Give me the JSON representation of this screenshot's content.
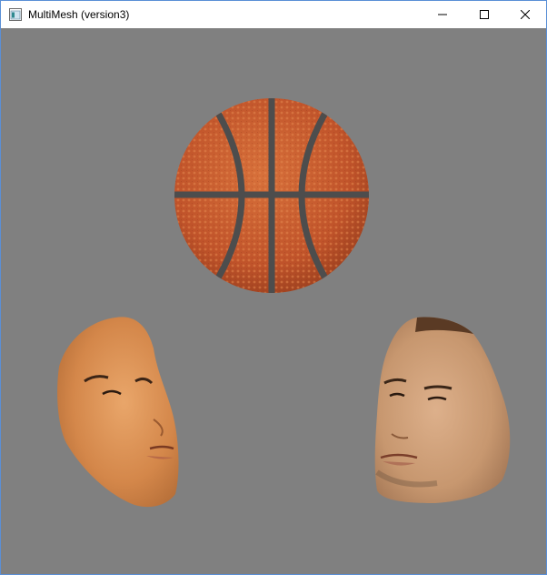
{
  "window": {
    "title": "MultiMesh (version3)",
    "background_color": "#808080"
  },
  "titlebar": {
    "app_icon": "window-app-icon",
    "buttons": [
      {
        "name": "minimize",
        "icon": "minimize-icon"
      },
      {
        "name": "maximize",
        "icon": "maximize-icon"
      },
      {
        "name": "close",
        "icon": "close-icon"
      }
    ]
  },
  "scene": {
    "objects": [
      {
        "name": "basketball",
        "color": "#c4572a",
        "seam_color": "#4a4a4a"
      },
      {
        "name": "face-left",
        "color": "#d98c52"
      },
      {
        "name": "face-right",
        "color": "#c99a74"
      }
    ]
  }
}
